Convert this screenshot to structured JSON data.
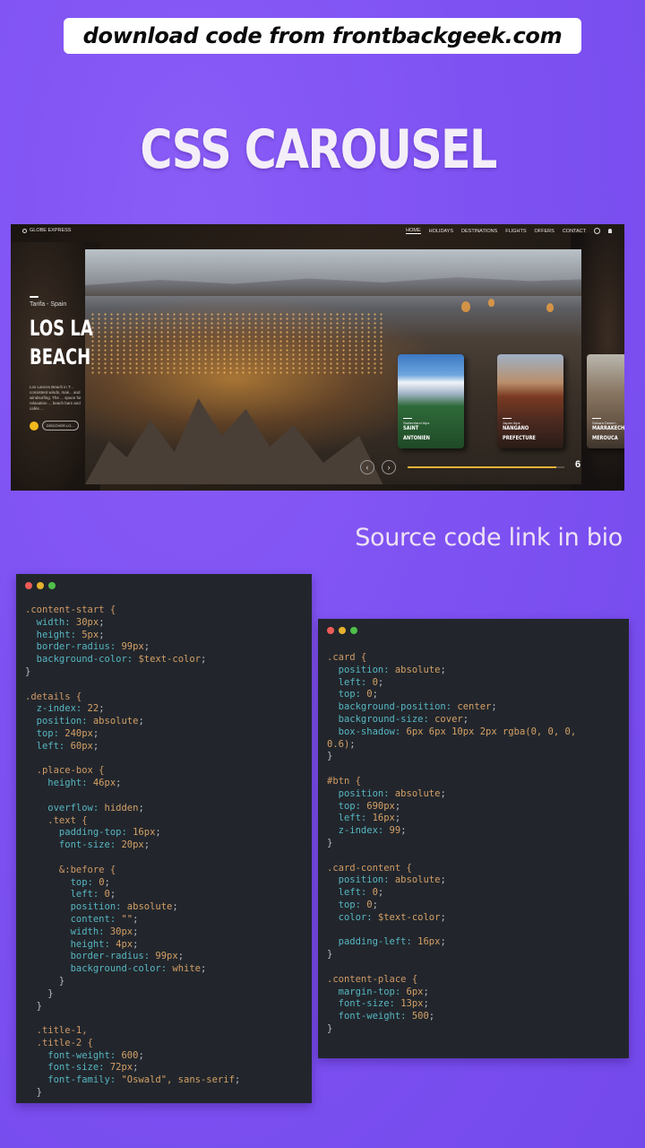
{
  "banner": {
    "text": "download code from frontbackgeek.com"
  },
  "headline": "CSS CAROUSEL",
  "preview": {
    "brand": "GLOBE EXPRESS",
    "nav": [
      "HOME",
      "HOLIDAYS",
      "DESTINATIONS",
      "FLIGHTS",
      "OFFERS",
      "CONTACT"
    ],
    "place_sub": "Tarifa - Spain",
    "place_title": "LOS LA\nBEACH",
    "place_desc": "Los Lances Beach in T... consistent winds, mak... and windsurfing. The ... space for relaxation ... beach bars and cafés ...",
    "discover_label": "DISCOVER LO...",
    "cards": [
      {
        "sub": "Switzerland Alps",
        "title": "SAINT\nANTONIEN"
      },
      {
        "sub": "Japan Alps",
        "title": "NANGANO\nPREFECTURE"
      },
      {
        "sub": "Sahara Desert -",
        "title": "MARRAKECH\nMEROUCA"
      }
    ],
    "prev_icon": "chevron-left-icon",
    "next_icon": "chevron-right-icon",
    "progress": 0.95,
    "slide_number": "6"
  },
  "bio": "Source code link in bio",
  "colors": {
    "background": "#7e52f2",
    "panel": "#22262c",
    "accent": "#e2b23a"
  },
  "code_left": [
    [
      [
        "sel",
        ".content-start {"
      ]
    ],
    [
      [
        "prop",
        "  width: "
      ],
      [
        "val",
        "30px"
      ],
      [
        "pun",
        ";"
      ]
    ],
    [
      [
        "prop",
        "  height: "
      ],
      [
        "val",
        "5px"
      ],
      [
        "pun",
        ";"
      ]
    ],
    [
      [
        "prop",
        "  border-radius: "
      ],
      [
        "val",
        "99px"
      ],
      [
        "pun",
        ";"
      ]
    ],
    [
      [
        "prop",
        "  background-color: "
      ],
      [
        "val",
        "$text-color"
      ],
      [
        "pun",
        ";"
      ]
    ],
    [
      [
        "pun",
        "}"
      ]
    ],
    [
      [
        "pun",
        ""
      ]
    ],
    [
      [
        "sel",
        ".details {"
      ]
    ],
    [
      [
        "prop",
        "  z-index: "
      ],
      [
        "val",
        "22"
      ],
      [
        "pun",
        ";"
      ]
    ],
    [
      [
        "prop",
        "  position: "
      ],
      [
        "val",
        "absolute"
      ],
      [
        "pun",
        ";"
      ]
    ],
    [
      [
        "prop",
        "  top: "
      ],
      [
        "val",
        "240px"
      ],
      [
        "pun",
        ";"
      ]
    ],
    [
      [
        "prop",
        "  left: "
      ],
      [
        "val",
        "60px"
      ],
      [
        "pun",
        ";"
      ]
    ],
    [
      [
        "pun",
        ""
      ]
    ],
    [
      [
        "sel",
        "  .place-box {"
      ]
    ],
    [
      [
        "prop",
        "    height: "
      ],
      [
        "val",
        "46px"
      ],
      [
        "pun",
        ";"
      ]
    ],
    [
      [
        "pun",
        ""
      ]
    ],
    [
      [
        "prop",
        "    overflow: "
      ],
      [
        "val",
        "hidden"
      ],
      [
        "pun",
        ";"
      ]
    ],
    [
      [
        "sel",
        "    .text {"
      ]
    ],
    [
      [
        "prop",
        "      padding-top: "
      ],
      [
        "val",
        "16px"
      ],
      [
        "pun",
        ";"
      ]
    ],
    [
      [
        "prop",
        "      font-size: "
      ],
      [
        "val",
        "20px"
      ],
      [
        "pun",
        ";"
      ]
    ],
    [
      [
        "pun",
        ""
      ]
    ],
    [
      [
        "sel",
        "      &:before {"
      ]
    ],
    [
      [
        "prop",
        "        top: "
      ],
      [
        "val",
        "0"
      ],
      [
        "pun",
        ";"
      ]
    ],
    [
      [
        "prop",
        "        left: "
      ],
      [
        "val",
        "0"
      ],
      [
        "pun",
        ";"
      ]
    ],
    [
      [
        "prop",
        "        position: "
      ],
      [
        "val",
        "absolute"
      ],
      [
        "pun",
        ";"
      ]
    ],
    [
      [
        "prop",
        "        content: "
      ],
      [
        "val",
        "\"\""
      ],
      [
        "pun",
        ";"
      ]
    ],
    [
      [
        "prop",
        "        width: "
      ],
      [
        "val",
        "30px"
      ],
      [
        "pun",
        ";"
      ]
    ],
    [
      [
        "prop",
        "        height: "
      ],
      [
        "val",
        "4px"
      ],
      [
        "pun",
        ";"
      ]
    ],
    [
      [
        "prop",
        "        border-radius: "
      ],
      [
        "val",
        "99px"
      ],
      [
        "pun",
        ";"
      ]
    ],
    [
      [
        "prop",
        "        background-color: "
      ],
      [
        "val",
        "white"
      ],
      [
        "pun",
        ";"
      ]
    ],
    [
      [
        "pun",
        "      }"
      ]
    ],
    [
      [
        "pun",
        "    }"
      ]
    ],
    [
      [
        "pun",
        "  }"
      ]
    ],
    [
      [
        "pun",
        ""
      ]
    ],
    [
      [
        "sel",
        "  .title-1,"
      ]
    ],
    [
      [
        "sel",
        "  .title-2 {"
      ]
    ],
    [
      [
        "prop",
        "    font-weight: "
      ],
      [
        "val",
        "600"
      ],
      [
        "pun",
        ";"
      ]
    ],
    [
      [
        "prop",
        "    font-size: "
      ],
      [
        "val",
        "72px"
      ],
      [
        "pun",
        ";"
      ]
    ],
    [
      [
        "prop",
        "    font-family: "
      ],
      [
        "val",
        "\"Oswald\", sans-serif"
      ],
      [
        "pun",
        ";"
      ]
    ],
    [
      [
        "pun",
        "  }"
      ]
    ]
  ],
  "code_right": [
    [
      [
        "sel",
        ".card {"
      ]
    ],
    [
      [
        "prop",
        "  position: "
      ],
      [
        "val",
        "absolute"
      ],
      [
        "pun",
        ";"
      ]
    ],
    [
      [
        "prop",
        "  left: "
      ],
      [
        "val",
        "0"
      ],
      [
        "pun",
        ";"
      ]
    ],
    [
      [
        "prop",
        "  top: "
      ],
      [
        "val",
        "0"
      ],
      [
        "pun",
        ";"
      ]
    ],
    [
      [
        "prop",
        "  background-position: "
      ],
      [
        "val",
        "center"
      ],
      [
        "pun",
        ";"
      ]
    ],
    [
      [
        "prop",
        "  background-size: "
      ],
      [
        "val",
        "cover"
      ],
      [
        "pun",
        ";"
      ]
    ],
    [
      [
        "prop",
        "  box-shadow: "
      ],
      [
        "val",
        "6px 6px 10px 2px rgba(0, 0, 0,"
      ]
    ],
    [
      [
        "val",
        "0.6)"
      ],
      [
        "pun",
        ";"
      ]
    ],
    [
      [
        "pun",
        "}"
      ]
    ],
    [
      [
        "pun",
        ""
      ]
    ],
    [
      [
        "sel",
        "#btn {"
      ]
    ],
    [
      [
        "prop",
        "  position: "
      ],
      [
        "val",
        "absolute"
      ],
      [
        "pun",
        ";"
      ]
    ],
    [
      [
        "prop",
        "  top: "
      ],
      [
        "val",
        "690px"
      ],
      [
        "pun",
        ";"
      ]
    ],
    [
      [
        "prop",
        "  left: "
      ],
      [
        "val",
        "16px"
      ],
      [
        "pun",
        ";"
      ]
    ],
    [
      [
        "prop",
        "  z-index: "
      ],
      [
        "val",
        "99"
      ],
      [
        "pun",
        ";"
      ]
    ],
    [
      [
        "pun",
        "}"
      ]
    ],
    [
      [
        "pun",
        ""
      ]
    ],
    [
      [
        "sel",
        ".card-content {"
      ]
    ],
    [
      [
        "prop",
        "  position: "
      ],
      [
        "val",
        "absolute"
      ],
      [
        "pun",
        ";"
      ]
    ],
    [
      [
        "prop",
        "  left: "
      ],
      [
        "val",
        "0"
      ],
      [
        "pun",
        ";"
      ]
    ],
    [
      [
        "prop",
        "  top: "
      ],
      [
        "val",
        "0"
      ],
      [
        "pun",
        ";"
      ]
    ],
    [
      [
        "prop",
        "  color: "
      ],
      [
        "val",
        "$text-color"
      ],
      [
        "pun",
        ";"
      ]
    ],
    [
      [
        "pun",
        ""
      ]
    ],
    [
      [
        "prop",
        "  padding-left: "
      ],
      [
        "val",
        "16px"
      ],
      [
        "pun",
        ";"
      ]
    ],
    [
      [
        "pun",
        "}"
      ]
    ],
    [
      [
        "pun",
        ""
      ]
    ],
    [
      [
        "sel",
        ".content-place {"
      ]
    ],
    [
      [
        "prop",
        "  margin-top: "
      ],
      [
        "val",
        "6px"
      ],
      [
        "pun",
        ";"
      ]
    ],
    [
      [
        "prop",
        "  font-size: "
      ],
      [
        "val",
        "13px"
      ],
      [
        "pun",
        ";"
      ]
    ],
    [
      [
        "prop",
        "  font-weight: "
      ],
      [
        "val",
        "500"
      ],
      [
        "pun",
        ";"
      ]
    ],
    [
      [
        "pun",
        "}"
      ]
    ]
  ]
}
